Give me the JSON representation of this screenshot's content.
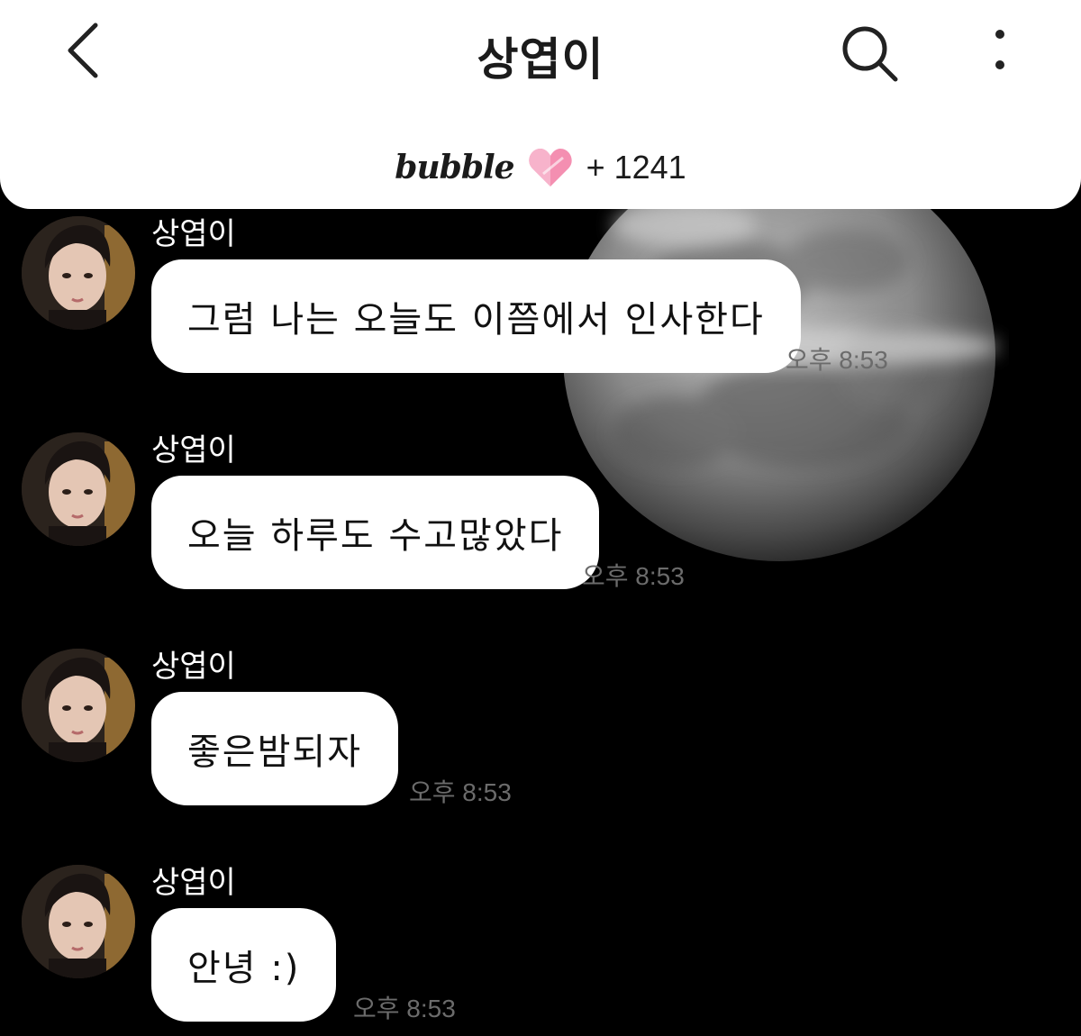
{
  "header": {
    "title": "상엽이",
    "brand": "bubble",
    "heart_count": "+ 1241"
  },
  "colors": {
    "header_bg": "#ffffff",
    "chat_bg": "#000000",
    "bubble_bg": "#ffffff",
    "heart": "#f47aa6",
    "time_text": "#6b6b6b"
  },
  "messages": [
    {
      "sender": "상엽이",
      "text": "그럼 나는 오늘도 이쯤에서 인사한다",
      "time": "오후 8:53"
    },
    {
      "sender": "상엽이",
      "text": "오늘 하루도 수고많았다",
      "time": "오후 8:53"
    },
    {
      "sender": "상엽이",
      "text": "좋은밤되자",
      "time": "오후 8:53"
    },
    {
      "sender": "상엽이",
      "text": "안녕 :)",
      "time": "오후 8:53"
    }
  ],
  "icons": [
    "back-arrow-icon",
    "search-icon",
    "more-vertical-icon",
    "heart-icon"
  ]
}
